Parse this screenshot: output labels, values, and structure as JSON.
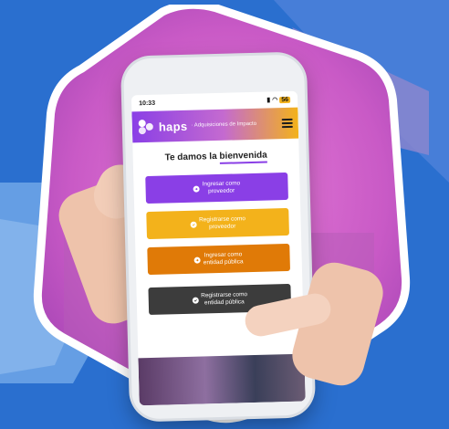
{
  "colors": {
    "background": "#2a6fcf",
    "brand_purple": "#8a3fe6",
    "brand_yellow": "#f3b21b",
    "brand_orange": "#e07a07",
    "dark_button": "#3c3c3c"
  },
  "status_bar": {
    "time": "10:33",
    "battery": "56"
  },
  "app_bar": {
    "brand": "haps",
    "tagline": "· Adquisiciones de Impacto",
    "menu_icon": "hamburger-icon"
  },
  "welcome": {
    "part1": "Te damos la",
    "part2": "bienvenida"
  },
  "buttons": [
    {
      "line1": "Ingresar como",
      "line2": "proveedor",
      "color": "#8a3fe6",
      "icon": "arrow-right-circle-icon"
    },
    {
      "line1": "Registrarse como",
      "line2": "proveedor",
      "color": "#f3b21b",
      "icon": "check-circle-icon"
    },
    {
      "line1": "Ingresar como",
      "line2": "entidad pública",
      "color": "#e07a07",
      "icon": "arrow-right-circle-icon"
    },
    {
      "line1": "Registrarse como",
      "line2": "entidad pública",
      "color": "#3c3c3c",
      "icon": "check-circle-icon"
    }
  ]
}
